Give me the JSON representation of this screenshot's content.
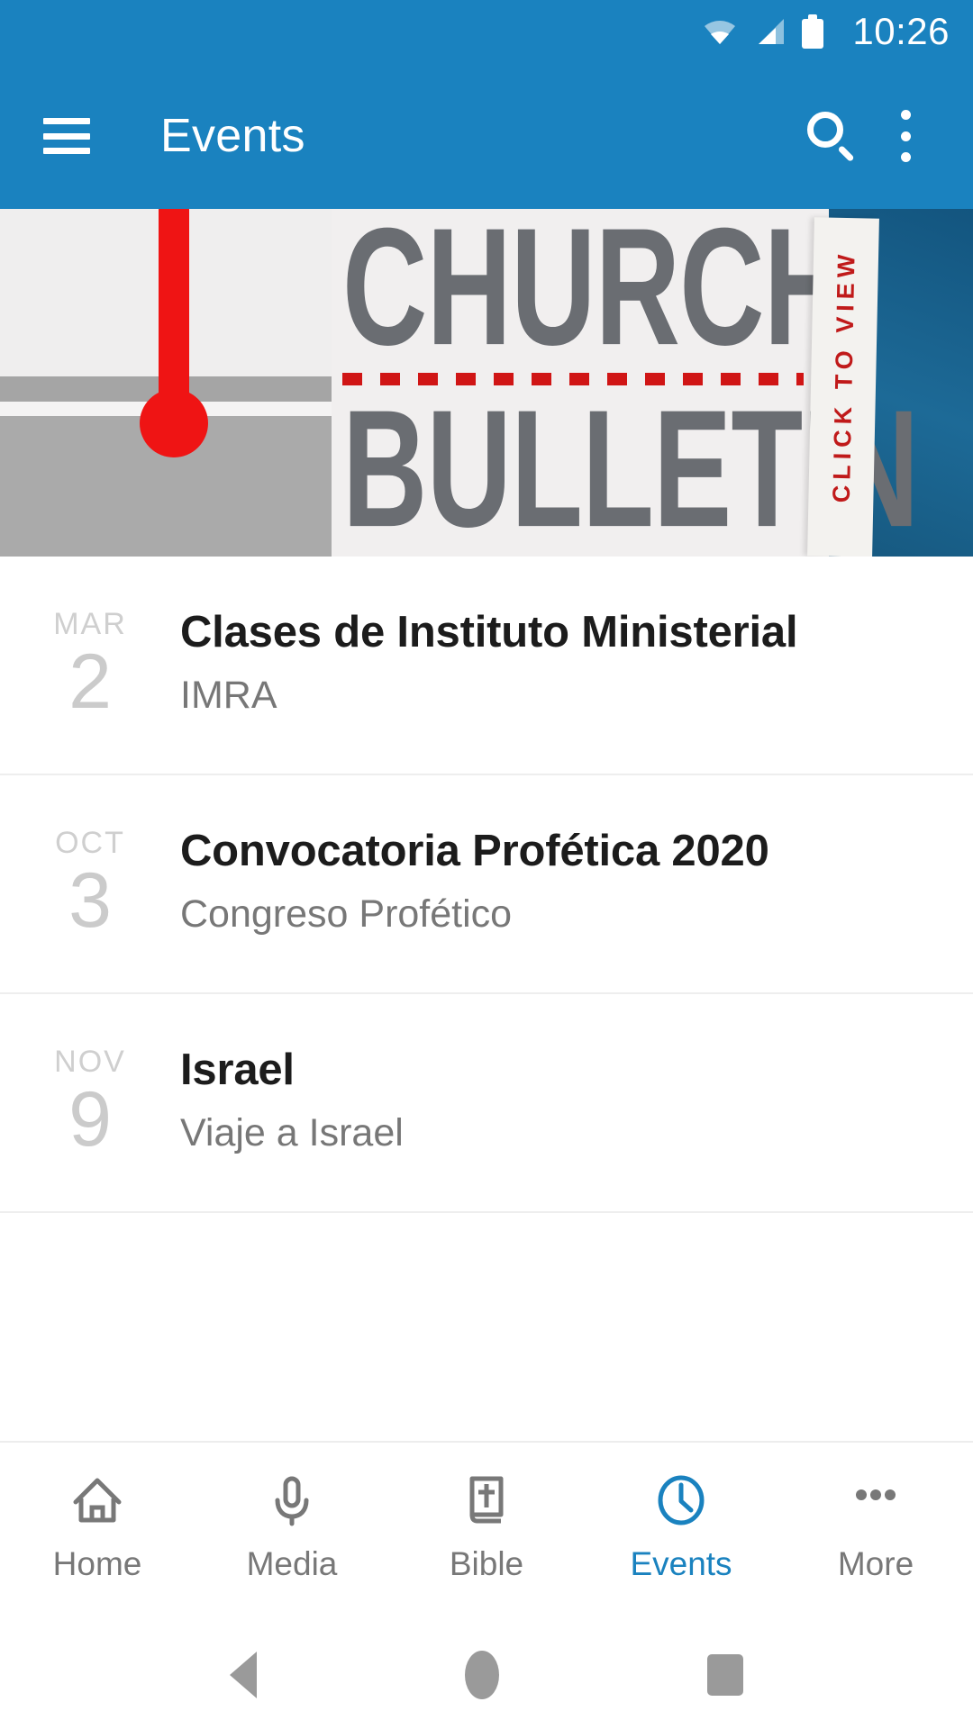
{
  "status_bar": {
    "time": "10:26",
    "icons": [
      "wifi-icon",
      "cellular-signal-icon",
      "battery-icon"
    ]
  },
  "app_bar": {
    "menu_icon": "hamburger-menu-icon",
    "title": "Events",
    "search_icon": "search-icon",
    "overflow_icon": "overflow-menu-icon"
  },
  "banner": {
    "line1": "CHURCH",
    "line2": "BULLETIN",
    "call_to_action": "CLICK TO VIEW",
    "colors": {
      "text_gray": "#6a6d72",
      "accent_red": "#c01a1a",
      "panel_blue": "#13557f"
    }
  },
  "events": [
    {
      "month": "MAR",
      "day": "2",
      "title": "Clases de Instituto Ministerial",
      "subtitle": "IMRA"
    },
    {
      "month": "OCT",
      "day": "3",
      "title": "Convocatoria Profética 2020",
      "subtitle": "Congreso Profético"
    },
    {
      "month": "NOV",
      "day": "9",
      "title": "Israel",
      "subtitle": "Viaje a Israel"
    }
  ],
  "bottom_nav": {
    "active_color": "#1a82bf",
    "inactive_color": "#787878",
    "items": [
      {
        "label": "Home",
        "icon": "home-icon",
        "active": false
      },
      {
        "label": "Media",
        "icon": "microphone-icon",
        "active": false
      },
      {
        "label": "Bible",
        "icon": "bible-book-icon",
        "active": false
      },
      {
        "label": "Events",
        "icon": "clock-icon",
        "active": true
      },
      {
        "label": "More",
        "icon": "ellipsis-icon",
        "active": false
      }
    ]
  },
  "android_nav": {
    "back": "back-triangle-icon",
    "home": "home-circle-icon",
    "recents": "recents-square-icon"
  },
  "theme": {
    "primary": "#1a82bf"
  }
}
